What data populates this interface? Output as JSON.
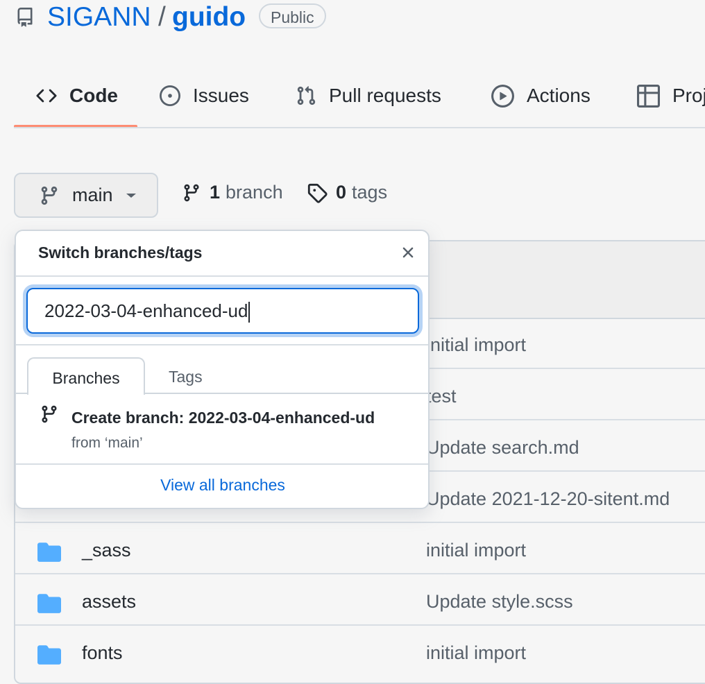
{
  "repo": {
    "owner": "SIGANN",
    "separator": "/",
    "name": "guido",
    "visibility": "Public"
  },
  "tabs": [
    {
      "label": "Code",
      "icon": "code-icon",
      "selected": true
    },
    {
      "label": "Issues",
      "icon": "issue-icon"
    },
    {
      "label": "Pull requests",
      "icon": "pull-request-icon"
    },
    {
      "label": "Actions",
      "icon": "play-icon"
    },
    {
      "label": "Proj",
      "icon": "table-icon"
    }
  ],
  "branch_bar": {
    "current_branch": "main",
    "branch_count": "1",
    "branch_word": "branch",
    "tag_count": "0",
    "tag_word": "tags"
  },
  "files": [
    {
      "name": "",
      "message": "initial import"
    },
    {
      "name": "",
      "message": "test"
    },
    {
      "name": "",
      "message": "Update search.md"
    },
    {
      "name": "",
      "message": "Update 2021-12-20-sitent.md"
    },
    {
      "name": "_sass",
      "message": "initial import"
    },
    {
      "name": "assets",
      "message": "Update style.scss"
    },
    {
      "name": "fonts",
      "message": "initial import"
    }
  ],
  "dropdown": {
    "title": "Switch branches/tags",
    "filter_value": "2022-03-04-enhanced-ud",
    "tab_branches": "Branches",
    "tab_tags": "Tags",
    "create_label": "Create branch: 2022-03-04-enhanced-ud",
    "create_from": "from ‘main’",
    "view_all": "View all branches"
  },
  "colors": {
    "accent": "#0969da",
    "tab_underline": "#fd8c73",
    "folder": "#54aeff"
  }
}
